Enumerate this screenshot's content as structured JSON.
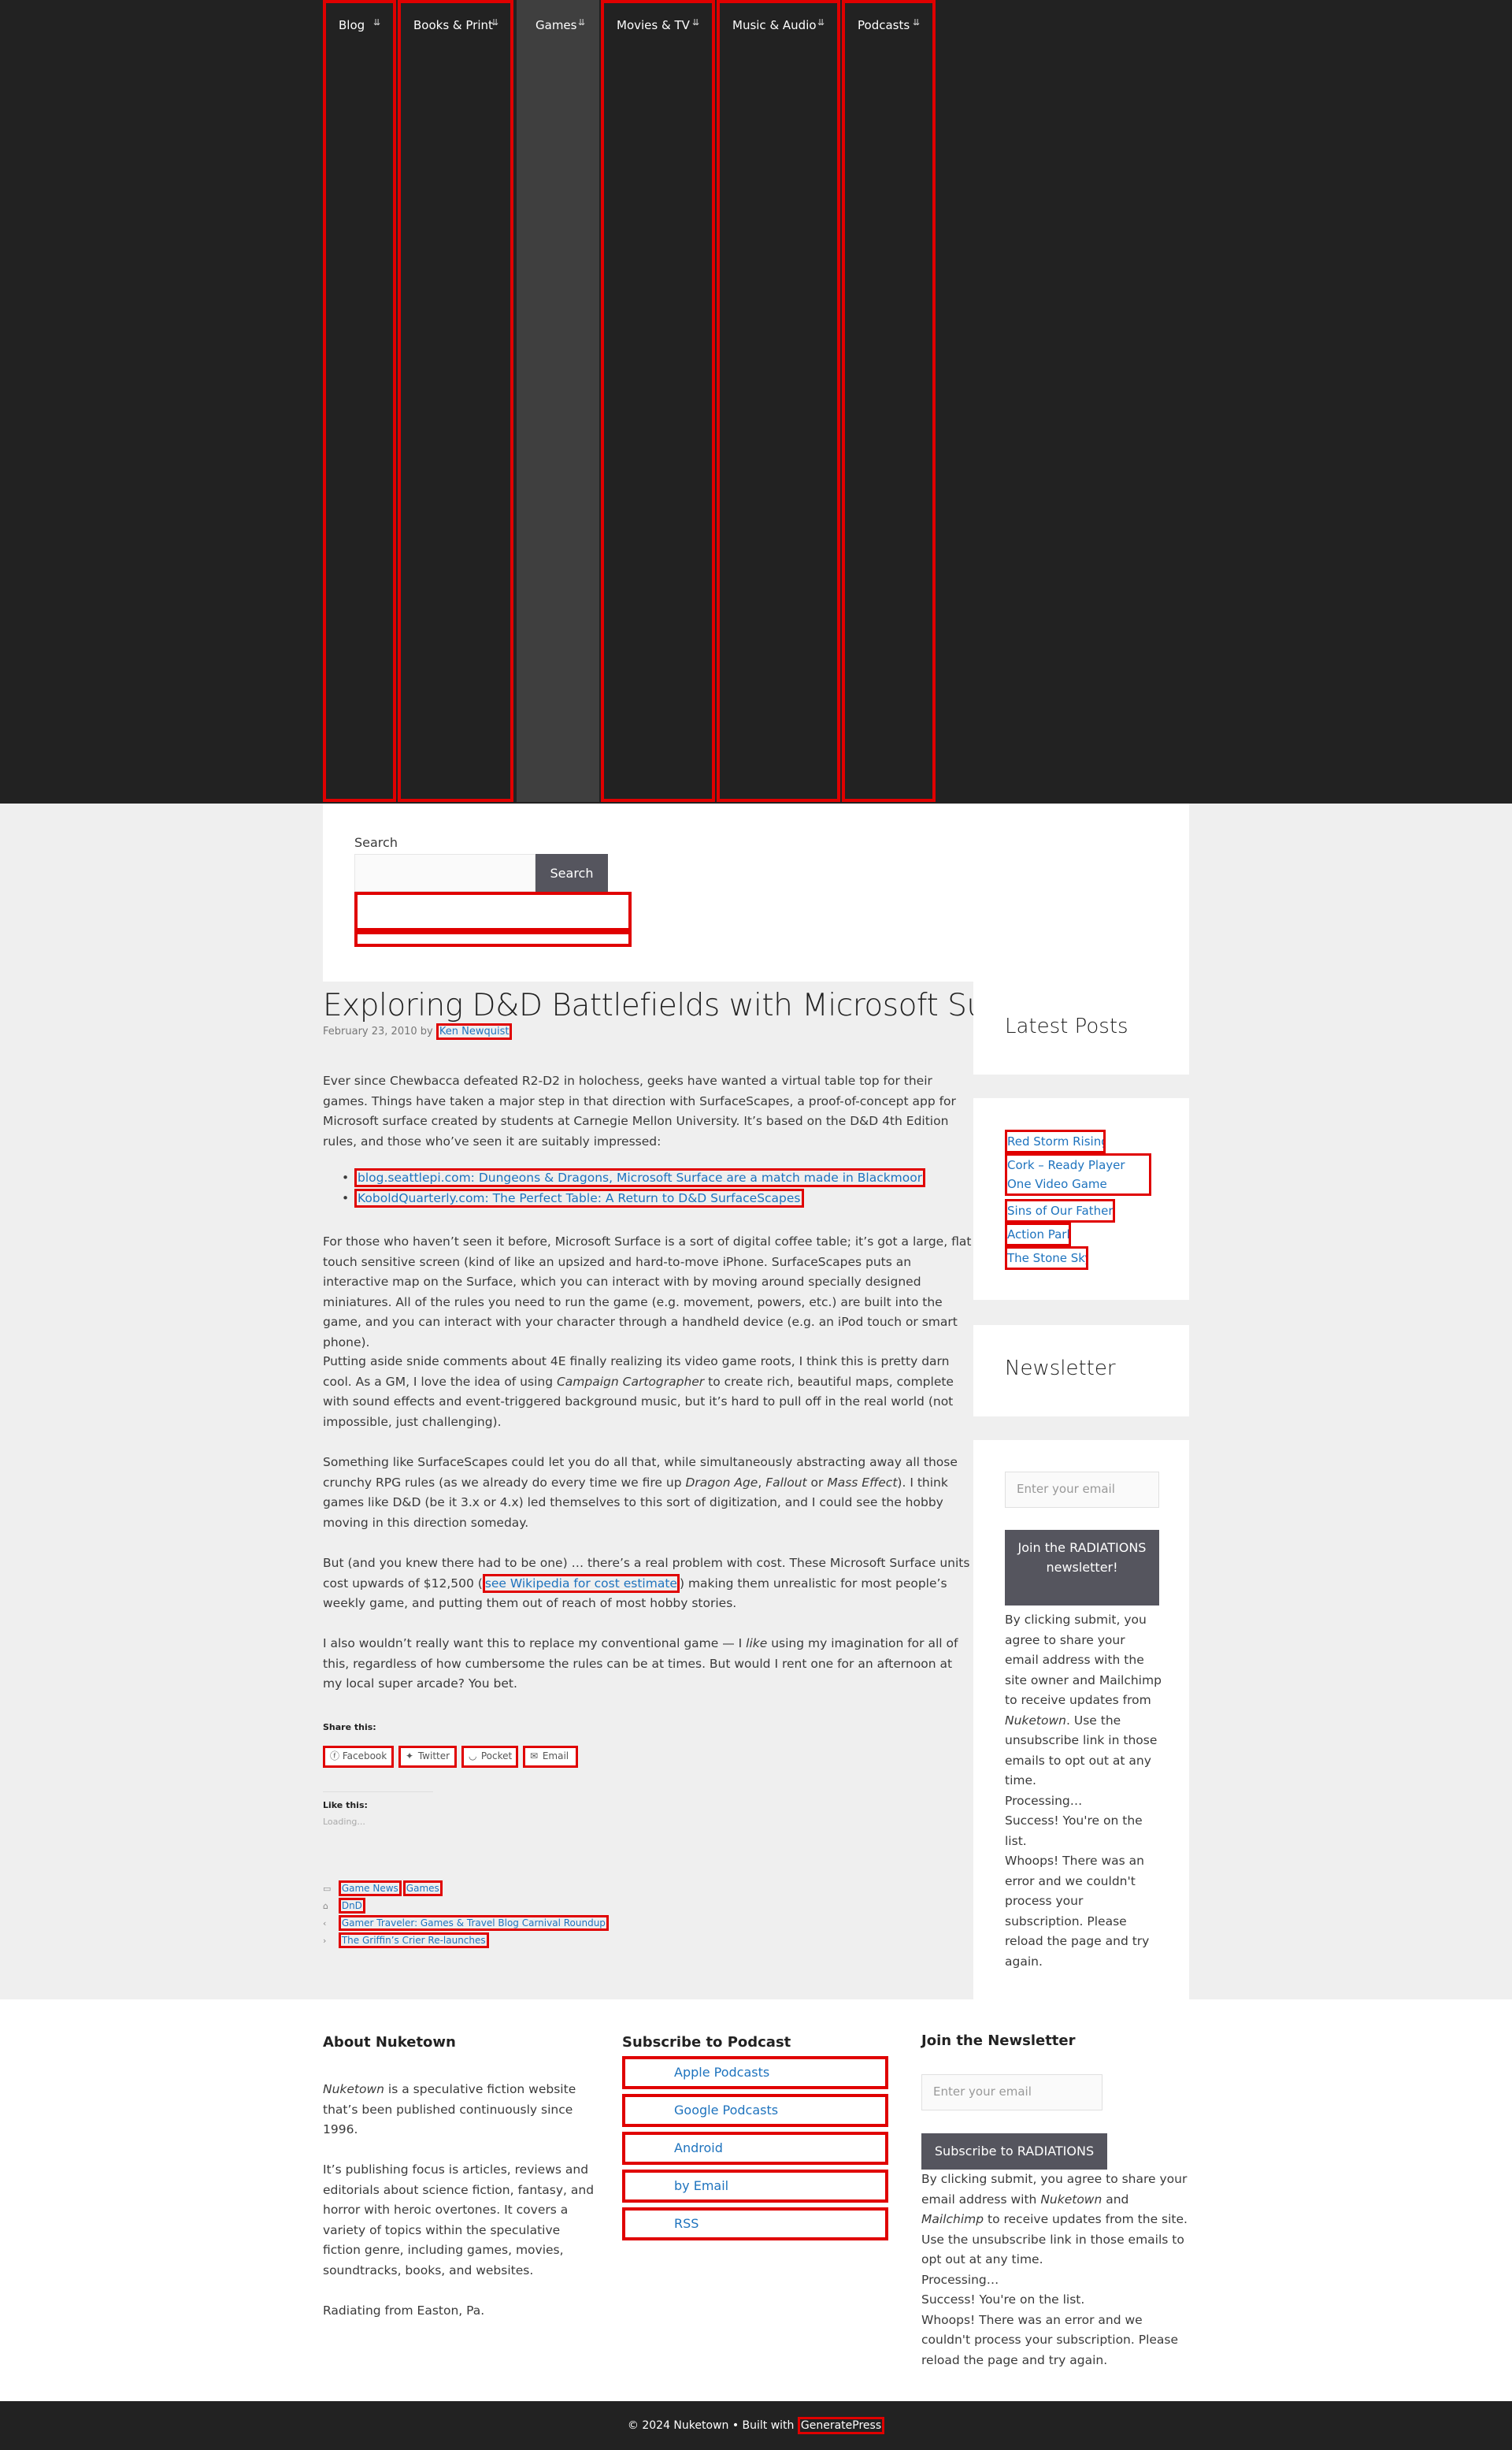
{
  "nav": {
    "items": [
      {
        "label": "Blog"
      },
      {
        "label": "Books & Print"
      },
      {
        "label": "Games"
      },
      {
        "label": "Movies & TV"
      },
      {
        "label": "Music & Audio"
      },
      {
        "label": "Podcasts"
      }
    ],
    "caret": "⇊",
    "active": "Games"
  },
  "search": {
    "label": "Search",
    "button": "Search",
    "value": ""
  },
  "post": {
    "title": "Exploring D&D Battlefields with Microsoft Surface",
    "date": "February 23, 2010",
    "by": "by",
    "author": "Ken Newquist",
    "p1": "Ever since Chewbacca defeated R2-D2 in holochess, geeks have wanted a virtual table top for their games. Things have taken a major step in that direction with SurfaceScapes, a proof-of-concept app for Microsoft surface created by students at Carnegie Mellon University. It’s based on the D&D 4th Edition rules, and those who’ve seen it are suitably impressed:",
    "links": [
      "blog.seattlepi.com: Dungeons & Dragons, Microsoft Surface are a match made in Blackmoor",
      "KoboldQuarterly.com: The Perfect Table: A Return to D&D SurfaceScapes"
    ],
    "p2": "For those who haven’t seen it before, Microsoft Surface is a sort of digital coffee table; it’s got a large, flat touch sensitive screen (kind of like an upsized and hard-to-move iPhone. SurfaceScapes puts an interactive map on the Surface, which you can interact with by moving around specially designed miniatures. All of the rules you need to run the game (e.g. movement, powers, etc.) are built into the game, and you can interact with your character through a handheld device (e.g. an iPod touch or smart phone).",
    "p3a": "Putting aside snide comments about 4E finally realizing its video game roots, I think this is pretty darn cool. As a GM, I love the idea of using ",
    "p3em": "Campaign Cartographer",
    "p3b": " to create rich, beautiful maps, complete with sound effects and event-triggered background music, but it’s hard to pull off in the real world (not impossible, just challenging).",
    "p4a": "Something like SurfaceScapes could let you do all that, while simultaneously abstracting away all those crunchy RPG rules (as we already do every time we fire up ",
    "p4em1": "Dragon Age",
    "p4c1": ", ",
    "p4em2": "Fallout",
    "p4c2": " or ",
    "p4em3": "Mass Effect",
    "p4b": "). I think games like D&D (be it 3.x or 4.x) led themselves to this sort of digitization, and I could see the hobby moving in this direction someday.",
    "p5a": "But (and you knew there had to be one) … there’s a real problem with cost. These Microsoft Surface units cost upwards of $12,500 (",
    "p5link": "see Wikipedia for cost estimate",
    "p5b": ") making them unrealistic for most people’s weekly game, and putting them out of reach of most hobby stories.",
    "p6a": "I also wouldn’t really want this to replace my conventional game — I ",
    "p6em": "like",
    "p6b": " using my imagination for all of this, regardless of how cumbersome the rules can be at times. But would I rent one for an afternoon at my local super arcade? You bet.",
    "share_heading": "Share this:",
    "share": [
      "Facebook",
      "Twitter",
      "Pocket",
      "Email"
    ],
    "like_heading": "Like this:",
    "like_loading": "Loading...",
    "categories": [
      "Game News",
      "Games"
    ],
    "tags": [
      "DnD"
    ],
    "prev": "Gamer Traveler: Games & Travel Blog Carnival Roundup",
    "next": "The Griffin’s Crier Re-launches"
  },
  "sidebar": {
    "latest_title": "Latest Posts",
    "latest": [
      "Red Storm Rising",
      "Cork – Ready Player One Video Game Replay",
      "Sins of Our Fathers",
      "Action Park",
      "The Stone Sky"
    ],
    "newsletter_title": "Newsletter",
    "email_placeholder": "Enter your email",
    "join_button": "Join the RADIATIONS newsletter!",
    "consent_a": "By clicking submit, you agree to share your email address with the site owner and Mailchimp to receive updates from ",
    "consent_em": "Nuketown",
    "consent_b": ". Use the unsubscribe link in those emails to opt out at any time.",
    "processing": "Processing…",
    "success": "Success! You're on the list.",
    "error": "Whoops! There was an error and we couldn't process your subscription. Please reload the page and try again."
  },
  "footer_widgets": {
    "about_title": "About Nuketown",
    "about_em": "Nuketown",
    "about_p1": " is a speculative fiction website that’s been published continuously since 1996.",
    "about_p2": "It’s publishing focus is articles, reviews and editorials about science fiction, fantasy, and horror with heroic overtones. It covers a variety of topics within the speculative fiction genre, including games, movies, soundtracks, books, and websites.",
    "about_p3": "Radiating from Easton, Pa.",
    "podcast_title": "Subscribe to Podcast",
    "podcast_links": [
      "Apple Podcasts",
      "Google Podcasts",
      "Android",
      "by Email",
      "RSS"
    ],
    "newsletter_title": "Join the Newsletter",
    "email_placeholder": "Enter your email",
    "subscribe_button": "Subscribe to RADIATIONS",
    "consent_a": "By clicking submit, you agree to share your email address with ",
    "consent_em1": "Nuketown",
    "consent_and": " and ",
    "consent_em2": "Mailchimp",
    "consent_b": " to receive updates from the site. Use the unsubscribe link in those emails to opt out at any time.",
    "processing": "Processing…",
    "success": "Success! You're on the list.",
    "error": "Whoops! There was an error and we couldn't process your subscription. Please reload the page and try again."
  },
  "site_footer": {
    "copyright": "© 2024 Nuketown • Built with ",
    "builder": "GeneratePress"
  }
}
